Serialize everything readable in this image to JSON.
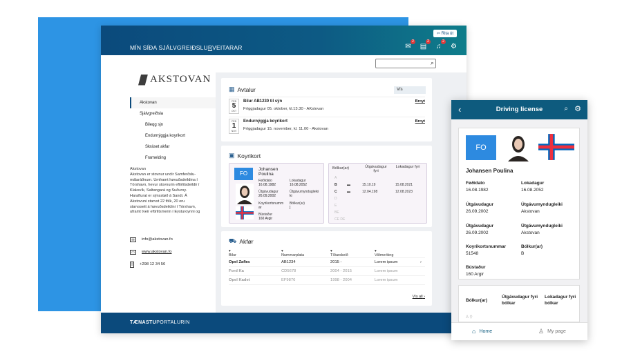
{
  "desktop": {
    "header": {
      "logout": "Rita út",
      "site_prefix": "MÍN SÍÐA SJÁLVGREIÐSLU",
      "site_underline": "R",
      "site_suffix": "VEITARAR",
      "badges": [
        "2",
        "2",
        "2"
      ]
    },
    "logo_text": "AKSTOVAN",
    "nav": {
      "items": [
        {
          "label": "Akstovan"
        },
        {
          "label": "Sjálvgreiðsla"
        },
        {
          "label": "Bileqg sjn"
        },
        {
          "label": "Endurnýggja koyrikort"
        },
        {
          "label": "Skráset akfar"
        },
        {
          "label": "Framelding"
        }
      ]
    },
    "about_lines": [
      "Akstovan",
      "Akstovan er stovnur undir Samferðslu-",
      "málaráðnum. Umframt høvuðsdeildina í",
      "Tórshavn, hevur stovnurin eftirlitsdeildir í",
      "Klaksvík, Saltangará og Suðuroy.",
      "Harafturat er sýnsstøð á Sandi. Á",
      "Akstovuni starvst 22 fólk, 20 eru",
      "starvssett á høvuðsdeildini í Tórshavn,",
      "uframt tveir eftirlitsmenn í Eysturoynni og"
    ],
    "contact": {
      "email": "info@akstovan.fo",
      "web": "www.akstovan.fo",
      "phone": "+298 12 34 56"
    },
    "avtalur": {
      "title": "Avtalur",
      "filter": "Vís",
      "appointments": [
        {
          "month": "FEB",
          "day": "5",
          "month2": "OKT",
          "title": "Bilur AB1230 til sýn",
          "sub": "Fríggjadagur 05. oktober, kl.13.30 - AKstovan",
          "action": "Broyt"
        },
        {
          "month": "FEB",
          "day": "1",
          "month2": "NOV",
          "title": "Endurnýggja koyrikort",
          "sub": "Fríggjadagur 15. november, kl. 11.00 - Akstovan",
          "action": "Broyt"
        }
      ]
    },
    "koyrikort": {
      "title": "Koyrikort",
      "fo": "FO",
      "name1": "Johansen",
      "name2": "Poulina",
      "fields": [
        {
          "k": "Føðidato",
          "v": "16.08.1982"
        },
        {
          "k": "Lokadagur",
          "v": "16.08.2052"
        },
        {
          "k": "Útgávudagur",
          "v": "26.09.2002"
        },
        {
          "k": "Útgávumyndugleiki",
          "v": "ki"
        },
        {
          "k": "Koyrikortsnumm",
          "v": "ar"
        },
        {
          "k": "Bólkur(ar)",
          "v": "]"
        },
        {
          "k": "Bústaður",
          "v": "160 Argir"
        }
      ],
      "table_headers": [
        "Bólkur(ar)",
        "Útgávudagur fyri",
        "Lokadagur fyri"
      ],
      "rows": [
        {
          "c": "A",
          "d1": "",
          "d2": ""
        },
        {
          "c": "B",
          "d1": "15.10.19",
          "d2": "15.08.2021"
        },
        {
          "c": "C",
          "d1": "12.04.198",
          "d2": "12.08.2023"
        },
        {
          "c": "D",
          "d1": "",
          "d2": ""
        },
        {
          "c": "E",
          "d1": "",
          "d2": ""
        },
        {
          "c": "BE",
          "d1": "",
          "d2": ""
        },
        {
          "c": "CE DE",
          "d1": "",
          "d2": ""
        }
      ]
    },
    "akfor": {
      "title": "Akfør",
      "headers": [
        "Bilur",
        "Nummarplata",
        "Tíðarskeið",
        "Viðmerking"
      ],
      "rows": [
        {
          "car": "Opel Zafira",
          "plate": "AB1234",
          "period": "2015 -",
          "note": "Lorem ipsum"
        },
        {
          "car": "Ford Ka",
          "plate": "CD5678",
          "period": "2004 - 2015",
          "note": "Lorem ipsum"
        },
        {
          "car": "Opel Kadet",
          "plate": "EF9876",
          "period": "1998 - 2004",
          "note": "Lorem ipsum"
        }
      ],
      "see_all": "Vís all"
    },
    "footer_bold": "TÆNASTU",
    "footer_rest": "PORTALURIN"
  },
  "mobile": {
    "title": "Driving license",
    "fo": "FO",
    "name": "Johansen Poulina",
    "fields": [
      {
        "k": "Føðidato",
        "v": "16.08.1982"
      },
      {
        "k": "Lokadagur",
        "v": "16.08.2052"
      },
      {
        "k": "Útgávudagur",
        "v": "26.09.2002"
      },
      {
        "k": "Útgávumyndugleiki",
        "v": "Akstovan"
      },
      {
        "k": "Útgávudagur",
        "v": "26.09.2002"
      },
      {
        "k": "Útgávumyndugleiki",
        "v": "Akstovan"
      },
      {
        "k": "Koyrikortsnummar",
        "v": "51548"
      },
      {
        "k": "Bólkur(ar)",
        "v": "B"
      },
      {
        "k": "Bústaður",
        "v": "160 Argir"
      }
    ],
    "table_headers": [
      "Bólkur(ar)",
      "Útgávudagur fyri bólkar",
      "Lokadagur fyri bólkar"
    ],
    "row_letter": "A",
    "nav": {
      "home": "Home",
      "mypage": "My page"
    }
  }
}
